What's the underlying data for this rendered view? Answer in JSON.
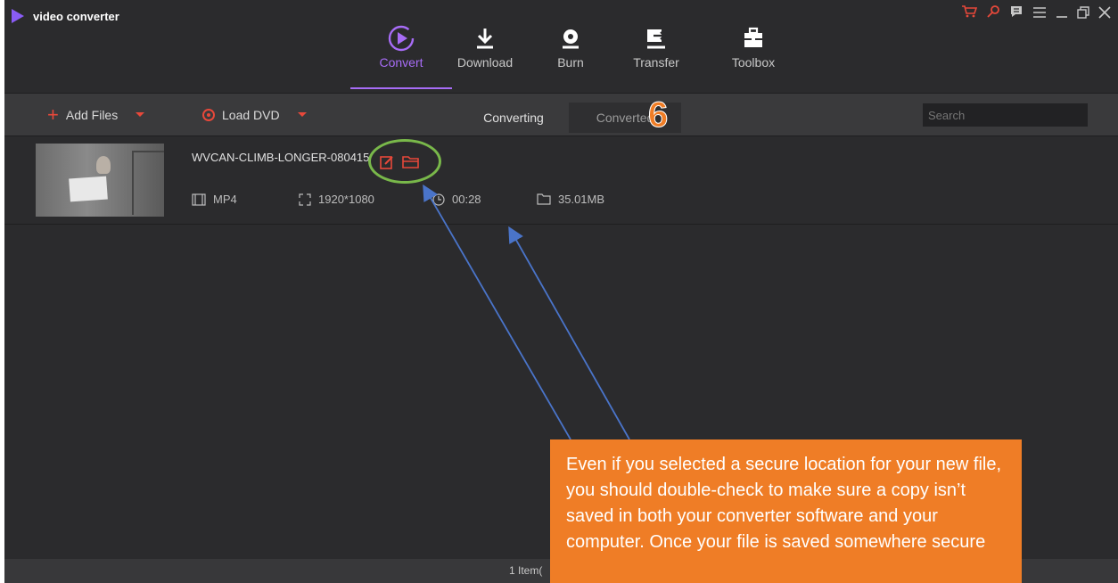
{
  "app": {
    "title": "video converter"
  },
  "window_controls": [
    "cart-icon",
    "key-icon",
    "chat-icon",
    "menu-icon",
    "minimize-icon",
    "restore-icon",
    "close-icon"
  ],
  "nav": {
    "tabs": [
      {
        "label": "Convert",
        "icon": "convert-icon",
        "active": true
      },
      {
        "label": "Download",
        "icon": "download-icon",
        "active": false
      },
      {
        "label": "Burn",
        "icon": "burn-icon",
        "active": false
      },
      {
        "label": "Transfer",
        "icon": "transfer-icon",
        "active": false
      },
      {
        "label": "Toolbox",
        "icon": "toolbox-icon",
        "active": false
      }
    ]
  },
  "toolbar": {
    "add_files": "Add Files",
    "load_dvd": "Load DVD",
    "converting": "Converting",
    "converted": "Converted",
    "search_placeholder": "Search"
  },
  "step_badge": "6",
  "file": {
    "name": "WVCAN-CLIMB-LONGER-080415",
    "format": "MP4",
    "resolution": "1920*1080",
    "duration": "00:28",
    "size": "35.01MB"
  },
  "footer": {
    "count": "1 Item("
  },
  "callout": {
    "text": "Even if you selected a secure location for your new file, you should double-check to make sure a copy isn’t saved in both your converter software and your computer. Once your file is saved somewhere secure"
  },
  "colors": {
    "accent": "#a76cf6",
    "red": "#e8483a",
    "callout": "#ef7d26",
    "highlight": "#79b84a",
    "arrow": "#4a74c9"
  }
}
